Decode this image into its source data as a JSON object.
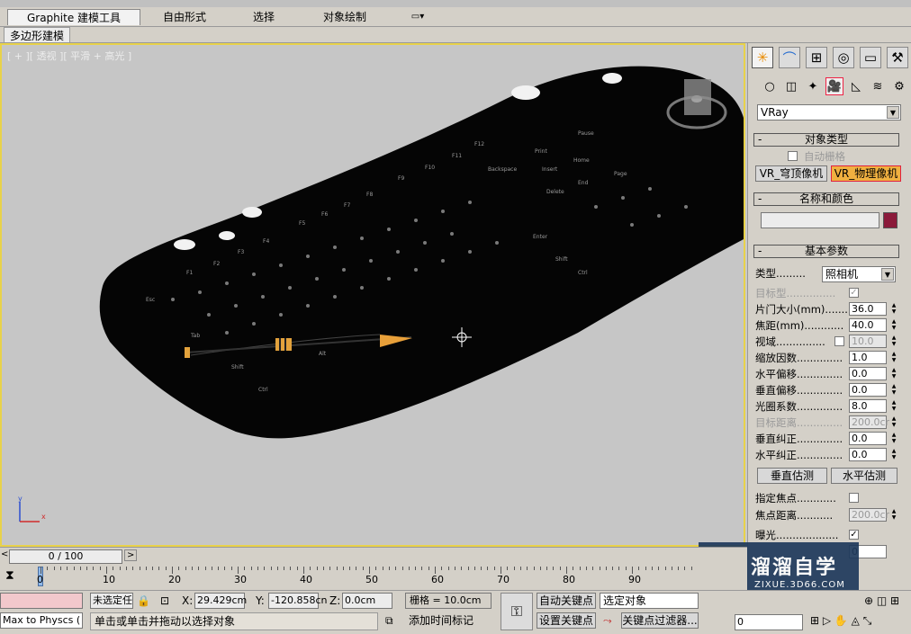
{
  "ribbon": {
    "tabs": [
      "Graphite 建模工具",
      "自由形式",
      "选择",
      "对象绘制"
    ],
    "active_tab": 0,
    "sub_tab": "多边形建模"
  },
  "viewport": {
    "label": "[ + ][ 透视 ][ 平滑 + 高光 ]",
    "object": "keyboard",
    "axis_x": "x",
    "axis_y": "y"
  },
  "command_panel": {
    "renderer_dropdown": "VRay",
    "object_type": {
      "title": "对象类型",
      "autogrid_label": "自动栅格",
      "buttons": [
        "VR_穹顶像机",
        "VR_物理像机"
      ],
      "selected": 1
    },
    "name_color": {
      "title": "名称和颜色",
      "name_value": "",
      "color": "#8b1a3a"
    },
    "basic_params": {
      "title": "基本参数",
      "type_label": "类型.........",
      "type_value": "照相机",
      "rows": [
        {
          "label": "目标型...............",
          "kind": "check",
          "value": "✓",
          "disabled": true
        },
        {
          "label": "片门大小(mm).......",
          "kind": "num",
          "value": "36.0"
        },
        {
          "label": "焦距(mm)............",
          "kind": "num",
          "value": "40.0"
        },
        {
          "label": "视域...............",
          "kind": "checknum",
          "value": "10.0",
          "disabled_value": true
        },
        {
          "label": "缩放因数..............",
          "kind": "num",
          "value": "1.0"
        },
        {
          "label": "水平偏移..............",
          "kind": "num",
          "value": "0.0"
        },
        {
          "label": "垂直偏移..............",
          "kind": "num",
          "value": "0.0"
        },
        {
          "label": "光圈系数..............",
          "kind": "num",
          "value": "8.0"
        },
        {
          "label": "目标距离..............",
          "kind": "num",
          "value": "200.0cr",
          "disabled": true
        },
        {
          "label": "垂直纠正..............",
          "kind": "num",
          "value": "0.0"
        },
        {
          "label": "水平纠正..............",
          "kind": "num",
          "value": "0.0"
        }
      ],
      "buttons": [
        "垂直估测",
        "水平估测"
      ],
      "focus_label": "指定焦点............",
      "focus_dist_label": "焦点距离...........",
      "focus_dist_value": "200.0cr",
      "exposure_label": "曝光...................",
      "exposure_checked": "✓",
      "partial_value": "0"
    }
  },
  "timeline": {
    "slider_label": "0 / 100",
    "ticks": [
      "0",
      "10",
      "20",
      "30",
      "40",
      "50",
      "60",
      "70",
      "80",
      "90"
    ]
  },
  "status": {
    "maxscript": "Max to Physcs (",
    "selection": "未选定任",
    "x_label": "X:",
    "x_value": "29.429cm",
    "y_label": "Y:",
    "y_value": "-120.858cn",
    "z_label": "Z:",
    "z_value": "0.0cm",
    "grid": "栅格 = 10.0cm",
    "auto_key": "自动关键点",
    "set_key": "设置关键点",
    "selected_obj": "选定对象",
    "key_filters": "关键点过滤器...",
    "prompt": "单击或单击并拖动以选择对象",
    "add_time_tag": "添加时间标记",
    "frame_value": "0"
  },
  "watermark": {
    "name": "溜溜自学",
    "url": "ZIXUE.3D66.COM"
  },
  "colors": {
    "viewport_bg": "#c6c6c6",
    "active_border": "#e8d24a",
    "accent_red": "#e02040"
  }
}
